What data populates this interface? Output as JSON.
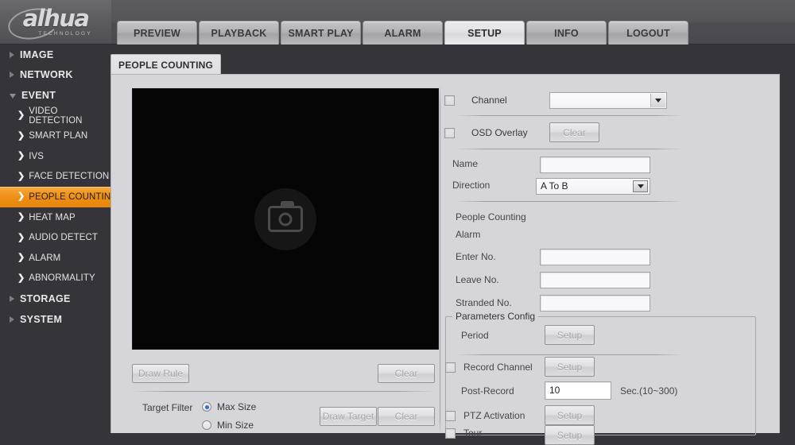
{
  "brand": {
    "name": "alhua",
    "tagline": "TECHNOLOGY"
  },
  "nav": {
    "tabs": [
      {
        "label": "PREVIEW",
        "active": false
      },
      {
        "label": "PLAYBACK",
        "active": false
      },
      {
        "label": "SMART PLAY",
        "active": false
      },
      {
        "label": "ALARM",
        "active": false
      },
      {
        "label": "SETUP",
        "active": true
      },
      {
        "label": "INFO",
        "active": false
      },
      {
        "label": "LOGOUT",
        "active": false
      }
    ]
  },
  "sidebar": {
    "items": [
      {
        "label": "IMAGE",
        "level": "top",
        "expanded": false
      },
      {
        "label": "NETWORK",
        "level": "top",
        "expanded": false
      },
      {
        "label": "EVENT",
        "level": "top",
        "expanded": true
      },
      {
        "label": "VIDEO DETECTION",
        "level": "sub",
        "selected": false
      },
      {
        "label": "SMART PLAN",
        "level": "sub",
        "selected": false
      },
      {
        "label": "IVS",
        "level": "sub",
        "selected": false
      },
      {
        "label": "FACE DETECTION",
        "level": "sub",
        "selected": false
      },
      {
        "label": "PEOPLE COUNTING",
        "level": "sub",
        "selected": true
      },
      {
        "label": "HEAT MAP",
        "level": "sub",
        "selected": false
      },
      {
        "label": "AUDIO DETECT",
        "level": "sub",
        "selected": false
      },
      {
        "label": "ALARM",
        "level": "sub",
        "selected": false
      },
      {
        "label": "ABNORMALITY",
        "level": "sub",
        "selected": false
      },
      {
        "label": "STORAGE",
        "level": "top",
        "expanded": false
      },
      {
        "label": "SYSTEM",
        "level": "top",
        "expanded": false
      }
    ]
  },
  "page": {
    "tab_label": "PEOPLE COUNTING"
  },
  "video": {
    "state_icon": "camera-no-signal-icon"
  },
  "left_controls": {
    "draw_rule_label": "Draw Rule",
    "clear_rule_label": "Clear",
    "target_filter_label": "Target Filter",
    "max_size_label": "Max Size",
    "min_size_label": "Min Size",
    "max_size_selected": true,
    "min_size_selected": false,
    "draw_target_label": "Draw Target",
    "clear_target_label": "Clear"
  },
  "form": {
    "channel_label": "Channel",
    "channel_checked": false,
    "channel_value": "",
    "osd_overlay_label": "OSD Overlay",
    "osd_overlay_checked": false,
    "osd_clear_label": "Clear",
    "name_label": "Name",
    "name_value": "",
    "direction_label": "Direction",
    "direction_value": "A To B",
    "section_title_line1": "People Counting",
    "section_title_line2": "Alarm",
    "enter_no_label": "Enter No.",
    "enter_no_value": "",
    "leave_no_label": "Leave No.",
    "leave_no_value": "",
    "stranded_no_label": "Stranded No.",
    "stranded_no_value": ""
  },
  "params": {
    "legend": "Parameters Config",
    "period_label": "Period",
    "period_button": "Setup",
    "record_channel_label": "Record Channel",
    "record_channel_checked": false,
    "record_channel_button": "Setup",
    "post_record_label": "Post-Record",
    "post_record_value": "10",
    "post_record_unit": "Sec.(10~300)",
    "ptz_activation_label": "PTZ Activation",
    "ptz_activation_checked": false,
    "ptz_activation_button": "Setup",
    "tour_label": "Tour",
    "tour_checked": false,
    "tour_button": "Setup"
  },
  "colors": {
    "accent": "#ef8f15",
    "panel_bg": "#d6d5d9",
    "chrome_bg": "#35343a",
    "radio_dot": "#2b6fd6"
  }
}
